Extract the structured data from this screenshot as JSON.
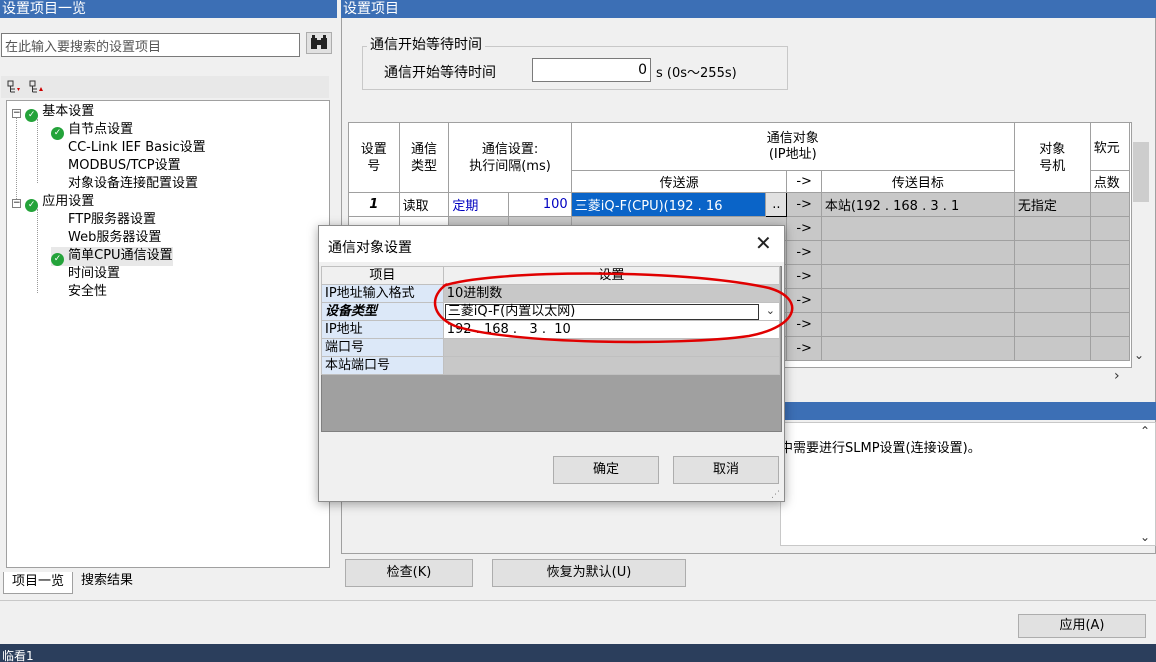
{
  "left_panel": {
    "title": "设置项目一览",
    "search_placeholder": "在此输入要搜索的设置项目",
    "tree": {
      "basic": "基本设置",
      "self_node": "自节点设置",
      "cclink": "CC-Link IEF Basic设置",
      "modbus": "MODBUS/TCP设置",
      "target_conn": "对象设备连接配置设置",
      "app": "应用设置",
      "ftp": "FTP服务器设置",
      "web": "Web服务器设置",
      "simple_cpu": "简单CPU通信设置",
      "time": "时间设置",
      "security": "安全性"
    },
    "tabs": [
      "项目一览",
      "搜索结果"
    ]
  },
  "right_panel": {
    "title": "设置项目",
    "group_title": "通信开始等待时间",
    "wait_label": "通信开始等待时间",
    "wait_value": "0",
    "wait_unit": "s (0s～255s)",
    "table": {
      "h_no_1": "设置",
      "h_no_2": "号",
      "h_type_1": "通信",
      "h_type_2": "类型",
      "h_setting_1": "通信设置:",
      "h_setting_2": "执行间隔(ms)",
      "h_target_1": "通信对象",
      "h_target_2": "(IP地址)",
      "h_source": "传送源",
      "h_arrow": "->",
      "h_dest": "传送目标",
      "h_obj_1": "对象",
      "h_obj_2": "号机",
      "h_soft": "软元",
      "h_points": "点数",
      "row1": {
        "no": "1",
        "type": "读取",
        "mode": "定期",
        "interval": "100",
        "source": "三菱iQ-F(CPU)(192 . 16",
        "ellipsis": "..",
        "arrow": "->",
        "dest": "本站(192 . 168 .   3 .  1",
        "obj": "无指定"
      },
      "arrow": "->"
    },
    "description": "中需要进行SLMP设置(连接设置)。",
    "check_button": "检查(K)",
    "default_button": "恢复为默认(U)"
  },
  "apply_button": "应用(A)",
  "status_text": "临看1",
  "dialog": {
    "title": "通信对象设置",
    "col_item": "项目",
    "col_setting": "设置",
    "rows": [
      {
        "label": "IP地址输入格式",
        "value": "10进制数"
      },
      {
        "label": "设备类型",
        "value": "三菱iQ-F(内置以太网)"
      },
      {
        "label": "IP地址",
        "value": "192 . 168 .   3 .  10"
      },
      {
        "label": "端口号",
        "value": ""
      },
      {
        "label": "本站端口号",
        "value": ""
      }
    ],
    "ok_button": "确定",
    "cancel_button": "取消"
  }
}
